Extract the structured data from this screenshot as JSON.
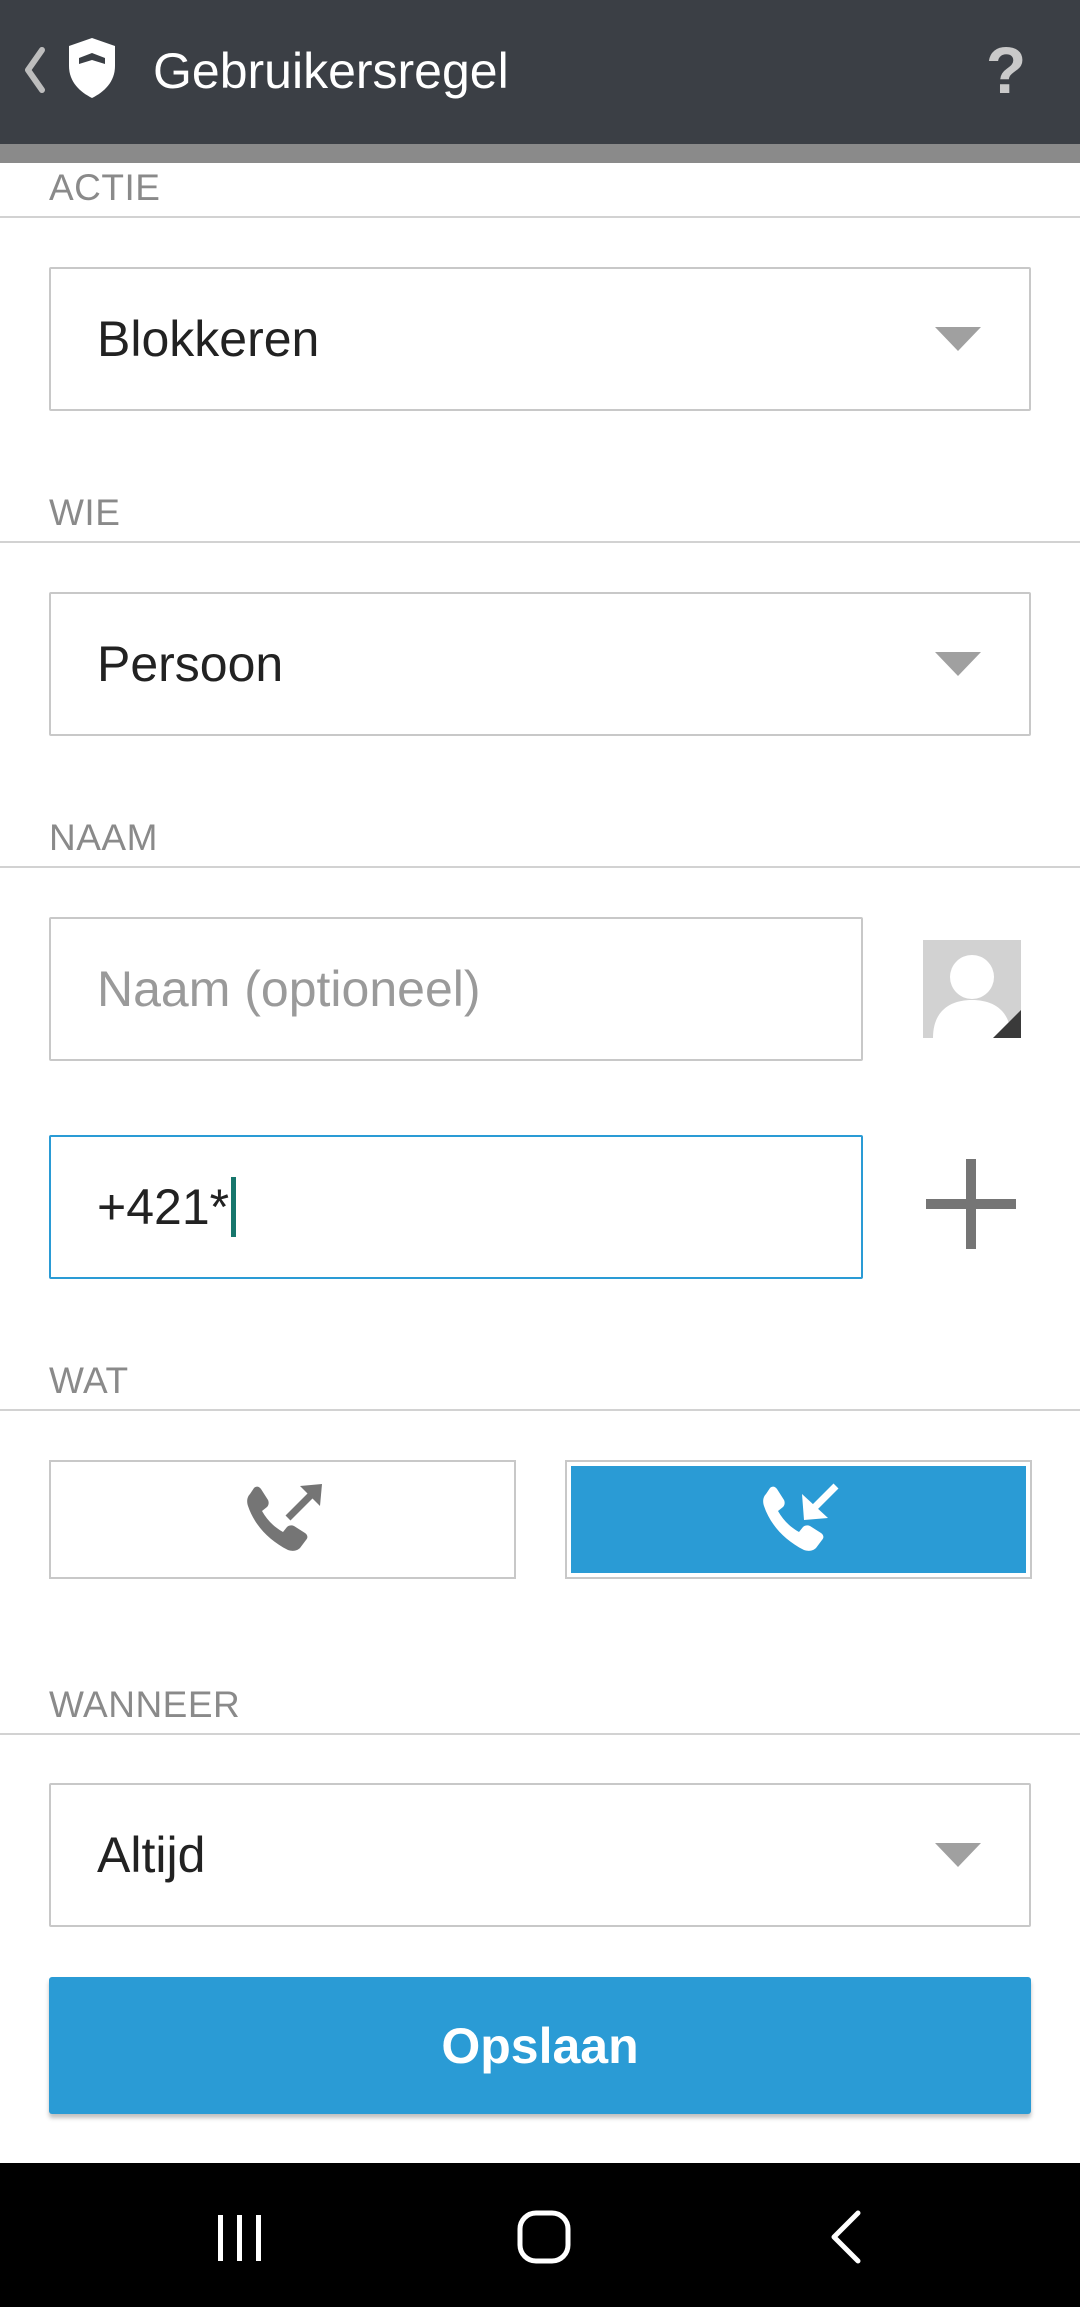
{
  "appbar": {
    "title": "Gebruikersregel",
    "help_label": "?"
  },
  "sections": {
    "actie": "ACTIE",
    "wie": "WIE",
    "naam": "NAAM",
    "wat": "WAT",
    "wanneer": "WANNEER"
  },
  "actie": {
    "selected": "Blokkeren"
  },
  "wie": {
    "selected": "Persoon"
  },
  "naam": {
    "placeholder": "Naam (optioneel)",
    "value": ""
  },
  "number": {
    "value": "+421*"
  },
  "wat": {
    "options": [
      {
        "icon": "outgoing-call-icon",
        "selected": false
      },
      {
        "icon": "incoming-call-icon",
        "selected": true
      }
    ]
  },
  "wanneer": {
    "selected": "Altijd"
  },
  "save_label": "Opslaan",
  "colors": {
    "appbar": "#3b3f45",
    "accent": "#2a9bd5",
    "caret": "#17766c"
  },
  "navbar": {
    "icons": [
      "recent-apps-icon",
      "home-icon",
      "back-icon"
    ]
  }
}
